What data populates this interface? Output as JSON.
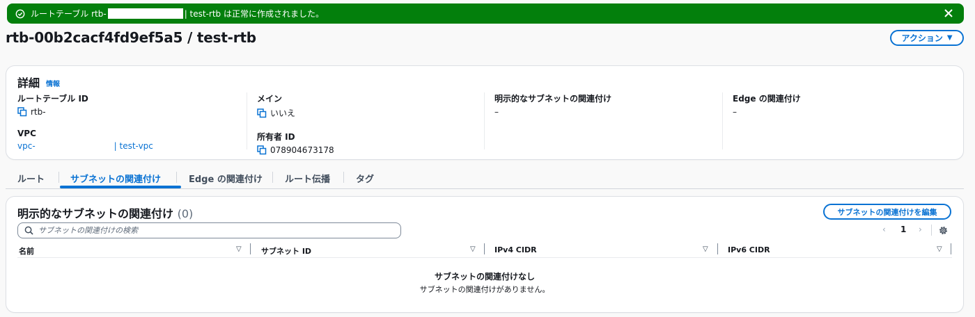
{
  "flash": {
    "message_prefix": "ルートテーブル rtb-",
    "message_suffix": "| test-rtb は正常に作成されました。",
    "color": "#037f0c",
    "icons": {
      "status": "success-check-icon",
      "close": "close-icon"
    }
  },
  "header": {
    "title": "rtb-00b2cacf4fd9ef5a5 / test-rtb",
    "actions_label": "アクション",
    "actions_caret": "▼"
  },
  "details": {
    "title": "詳細",
    "info_link": "情報",
    "route_table_id": {
      "label": "ルートテーブル ID",
      "value": "rtb-"
    },
    "vpc": {
      "label": "VPC",
      "value_id": "vpc-",
      "value_name": "| test-vpc"
    },
    "main": {
      "label": "メイン",
      "value": "いいえ"
    },
    "owner_id": {
      "label": "所有者 ID",
      "value": "078904673178"
    },
    "explicit_subnet": {
      "label": "明示的なサブネットの関連付け",
      "value": "–"
    },
    "edge_assoc": {
      "label": "Edge の関連付け",
      "value": "–"
    }
  },
  "tabs": [
    {
      "label": "ルート",
      "active": false
    },
    {
      "label": "サブネットの関連付け",
      "active": true
    },
    {
      "label": "Edge の関連付け",
      "active": false
    },
    {
      "label": "ルート伝播",
      "active": false
    },
    {
      "label": "タグ",
      "active": false
    }
  ],
  "associations": {
    "heading": "明示的なサブネットの関連付け",
    "count": "(0)",
    "edit_button": "サブネットの関連付けを編集",
    "search_placeholder": "サブネットの関連付けの検索",
    "pagination": {
      "prev": "‹",
      "page": "1",
      "next": "›"
    },
    "columns": [
      "名前",
      "サブネット ID",
      "IPv4 CIDR",
      "IPv6 CIDR"
    ],
    "empty_title": "サブネットの関連付けなし",
    "empty_text": "サブネットの関連付けがありません。"
  },
  "colors": {
    "accent": "#0972d3",
    "success": "#037f0c"
  }
}
